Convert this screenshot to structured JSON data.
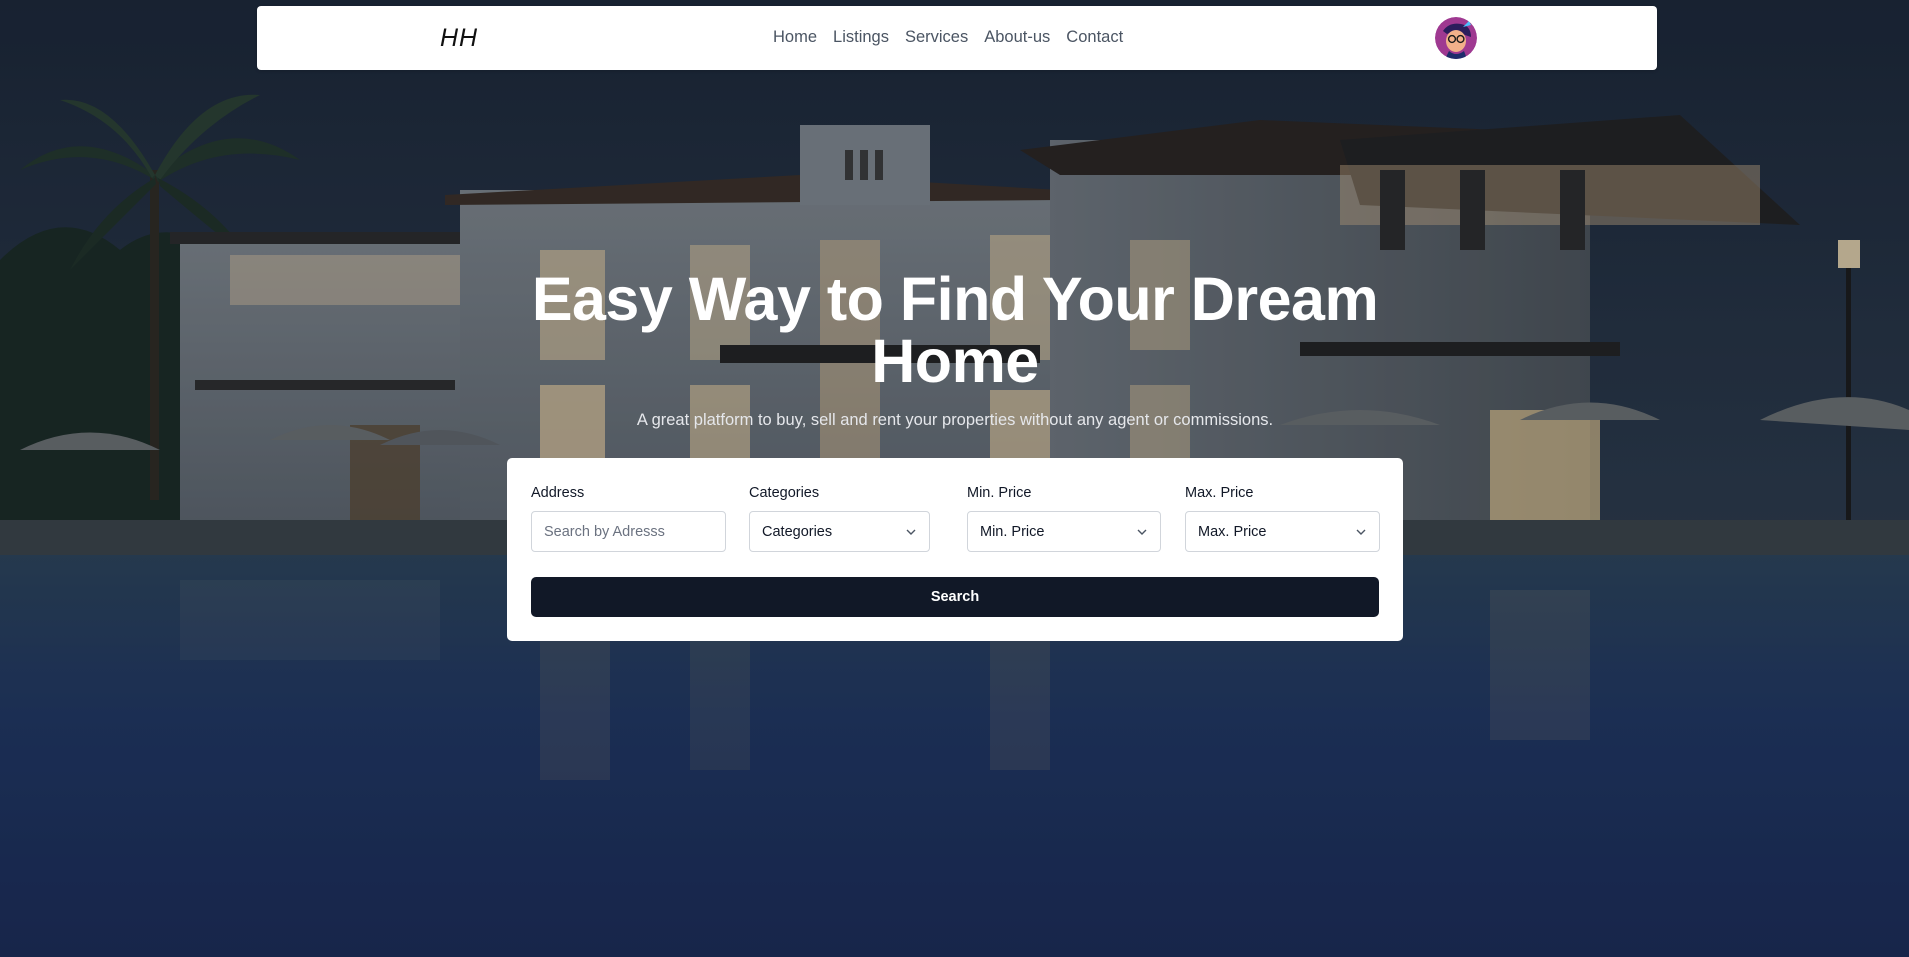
{
  "navbar": {
    "logo": "HH",
    "links": [
      {
        "label": "Home"
      },
      {
        "label": "Listings"
      },
      {
        "label": "Services"
      },
      {
        "label": "About-us"
      },
      {
        "label": "Contact"
      }
    ],
    "avatar_icon": "user-avatar-icon"
  },
  "hero": {
    "headline": "Easy Way to Find Your Dream Home",
    "subheadline": "A great platform to buy, sell and rent your properties without any agent or commissions."
  },
  "search": {
    "address_label": "Address",
    "address_placeholder": "Search by Adresss",
    "categories_label": "Categories",
    "categories_value": "Categories",
    "min_price_label": "Min. Price",
    "min_price_value": "Min. Price",
    "max_price_label": "Max. Price",
    "max_price_value": "Max. Price",
    "button_label": "Search"
  },
  "colors": {
    "button_bg": "#111827",
    "nav_text": "#4b5563"
  }
}
